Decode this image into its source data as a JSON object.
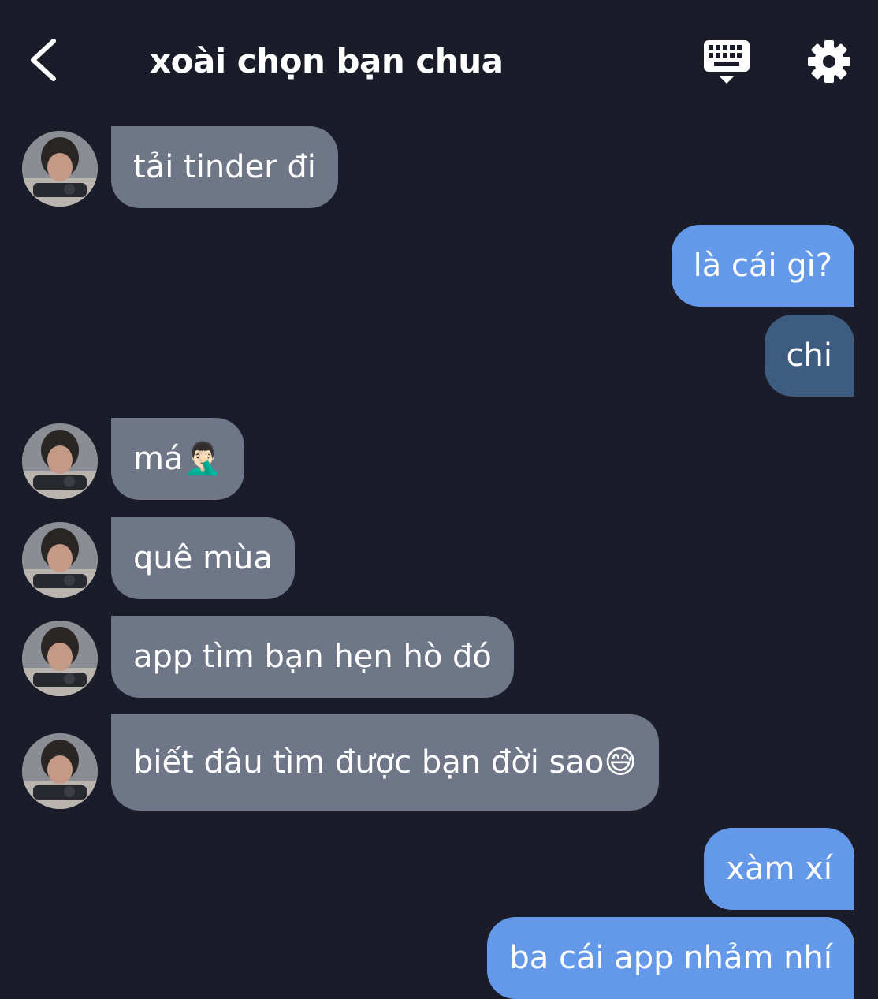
{
  "header": {
    "title": "xoài chọn bạn chua",
    "back_icon": "chevron-left-icon",
    "keyboard_icon": "keyboard-icon",
    "settings_icon": "gear-icon"
  },
  "colors": {
    "background": "#1a1d29",
    "received_bubble": "#6e7687",
    "sent_bubble": "#6499e9",
    "sent_bubble_alt": "#3e5b80",
    "text": "#ffffff"
  },
  "messages": [
    {
      "from": "them",
      "text": "tải tinder đi"
    },
    {
      "from": "me",
      "text": "là cái gì?"
    },
    {
      "from": "me",
      "text": "chi"
    },
    {
      "from": "them",
      "text": "má🤦🏻‍♂️"
    },
    {
      "from": "them",
      "text": "quê mùa"
    },
    {
      "from": "them",
      "text": "app tìm bạn hẹn hò đó"
    },
    {
      "from": "them",
      "text": "biết đâu tìm được bạn đời sao😅"
    },
    {
      "from": "me",
      "text": "xàm xí"
    },
    {
      "from": "me",
      "text": "ba cái app nhảm nhí"
    }
  ]
}
